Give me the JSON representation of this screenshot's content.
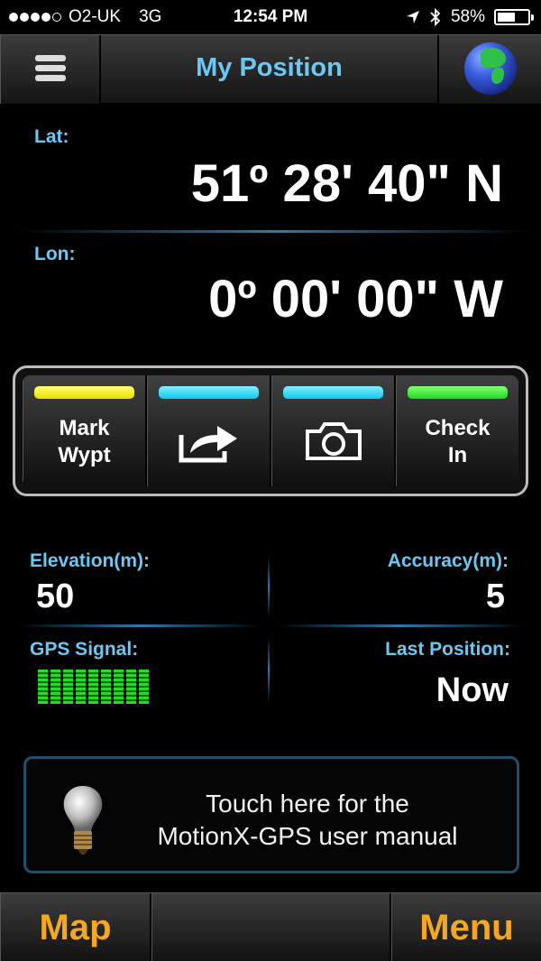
{
  "status_bar": {
    "carrier": "O2-UK",
    "network": "3G",
    "time": "12:54 PM",
    "battery": "58%",
    "battery_level": 0.58,
    "signal_bars_filled": 4,
    "signal_bars_total": 5
  },
  "header": {
    "title": "My Position",
    "menu_icon": "hamburger-icon",
    "right_icon": "globe-icon"
  },
  "position": {
    "lat_label": "Lat:",
    "lat_value": "51º 28' 40\" N",
    "lon_label": "Lon:",
    "lon_value": "0º 00' 00\" W"
  },
  "actions": [
    {
      "label_line1": "Mark",
      "label_line2": "Wypt",
      "led": "#f0ea00"
    },
    {
      "icon": "share-icon",
      "led": "#20c8f0"
    },
    {
      "icon": "camera-icon",
      "led": "#20c8f0"
    },
    {
      "label_line1": "Check",
      "label_line2": "In",
      "led": "#30dd30"
    }
  ],
  "stats": {
    "elevation_label": "Elevation(m):",
    "elevation_value": "50",
    "accuracy_label": "Accuracy(m):",
    "accuracy_value": "5",
    "gps_label": "GPS Signal:",
    "gps_bars": 9,
    "last_label": "Last Position:",
    "last_value": "Now"
  },
  "manual": {
    "line1": "Touch here for the",
    "line2": "MotionX-GPS user manual",
    "icon": "lightbulb-icon"
  },
  "bottom_bar": {
    "left": "Map",
    "right": "Menu"
  },
  "colors": {
    "accent_blue": "#6cc8f3",
    "bottom_label": "#f5a623"
  }
}
